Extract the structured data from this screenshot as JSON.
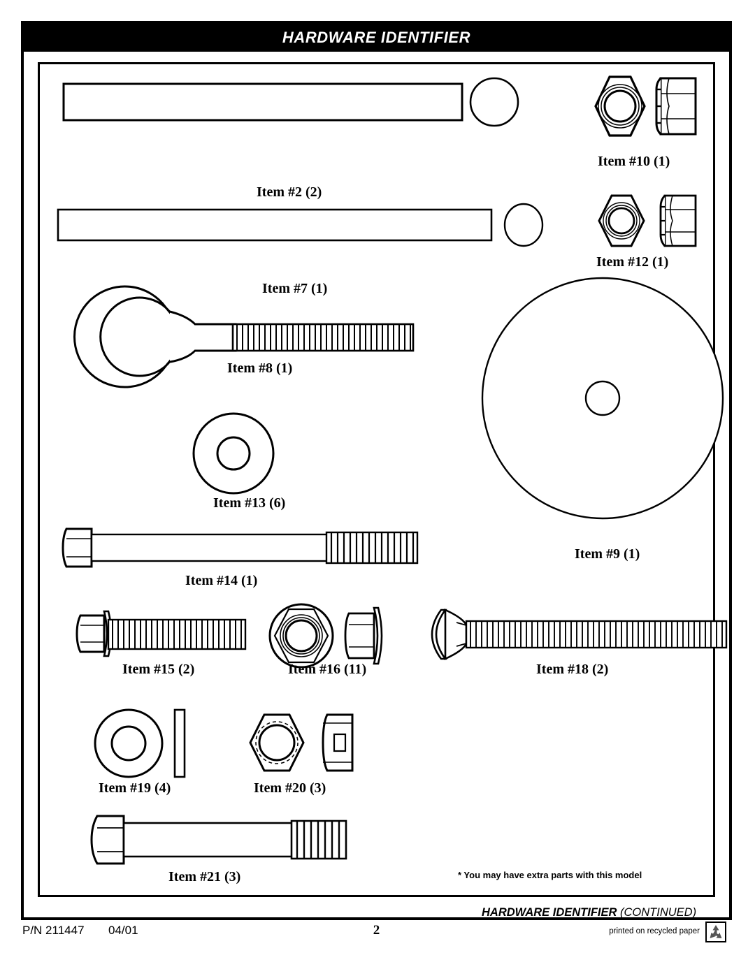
{
  "header": {
    "title": "HARDWARE IDENTIFIER"
  },
  "footer": {
    "part_number": "P/N 211447",
    "date": "04/01",
    "page_number": "2",
    "recycled_text": "printed on recycled paper",
    "recycle_icon": "recycle-icon"
  },
  "notes": {
    "extra_parts": "* You may have extra parts with this model",
    "continued_bold": "HARDWARE IDENTIFIER",
    "continued_italic": "(CONTINUED)"
  },
  "parts": [
    {
      "id": "item-2",
      "label": "Item #2",
      "qty": "(2)",
      "type": "tube-long",
      "desc": "long rod with end cap"
    },
    {
      "id": "item-7",
      "label": "Item #7",
      "qty": "(1)",
      "type": "tube-medium",
      "desc": "medium rod with end cap"
    },
    {
      "id": "item-10",
      "label": "Item #10",
      "qty": "(1)",
      "type": "lock-nut-large",
      "desc": "large nylon lock nut"
    },
    {
      "id": "item-12",
      "label": "Item #12",
      "qty": "(1)",
      "type": "lock-nut-small",
      "desc": "small nylon lock nut"
    },
    {
      "id": "item-8",
      "label": "Item #8",
      "qty": "(1)",
      "type": "eye-bolt",
      "desc": "eye bolt with threaded shaft"
    },
    {
      "id": "item-13",
      "label": "Item #13",
      "qty": "(6)",
      "type": "washer-small",
      "desc": "flat washer"
    },
    {
      "id": "item-9",
      "label": "Item #9",
      "qty": "(1)",
      "type": "disc-large",
      "desc": "large disc / plate"
    },
    {
      "id": "item-14",
      "label": "Item #14",
      "qty": "(1)",
      "type": "hex-bolt-long",
      "desc": "long hex head bolt"
    },
    {
      "id": "item-15",
      "label": "Item #15",
      "qty": "(2)",
      "type": "flange-bolt",
      "desc": "hex flange bolt"
    },
    {
      "id": "item-16",
      "label": "Item #16",
      "qty": "(11)",
      "type": "flange-nut",
      "desc": "hex flange nut"
    },
    {
      "id": "item-18",
      "label": "Item #18",
      "qty": "(2)",
      "type": "carriage-bolt",
      "desc": "carriage bolt"
    },
    {
      "id": "item-19",
      "label": "Item #19",
      "qty": "(4)",
      "type": "washer-flat",
      "desc": "flat washer with edge view"
    },
    {
      "id": "item-20",
      "label": "Item #20",
      "qty": "(3)",
      "type": "hex-nut",
      "desc": "hex nut"
    },
    {
      "id": "item-21",
      "label": "Item #21",
      "qty": "(3)",
      "type": "hex-bolt-short",
      "desc": "short hex head bolt"
    }
  ],
  "colors": {
    "ink": "#000000",
    "paper": "#ffffff",
    "header_bg": "#000000",
    "header_fg": "#ffffff"
  }
}
